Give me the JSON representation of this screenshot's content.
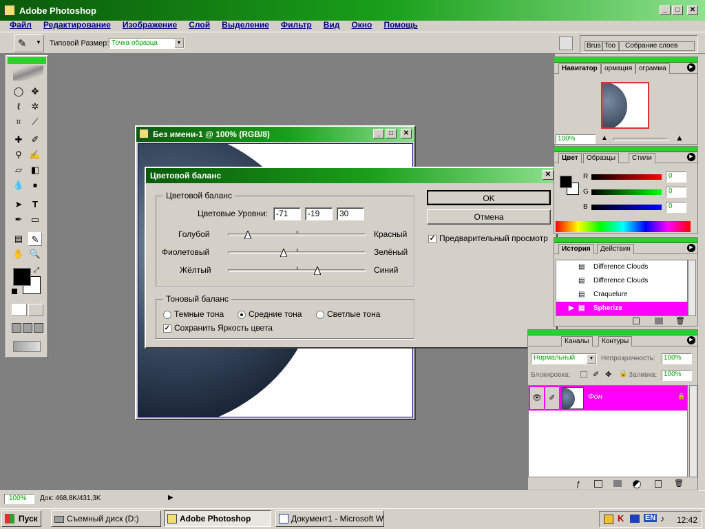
{
  "app": {
    "title": "Adobe Photoshop"
  },
  "menu": [
    "Файл",
    "Редактирование",
    "Изображение",
    "Слой",
    "Выделение",
    "Фильтр",
    "Вид",
    "Окно",
    "Помощь"
  ],
  "options": {
    "sample_label": "Типовой Размер:",
    "sample_value": "Точка образца"
  },
  "palette_well": {
    "tabs": [
      "Brus",
      "Too",
      "Собрание слоев"
    ]
  },
  "document": {
    "title": "Без имени-1 @ 100% (RGB/8)"
  },
  "dialog": {
    "title": "Цветовой баланс",
    "group1_title": "Цветовой баланс",
    "levels_label": "Цветовые Уровни:",
    "levels": [
      "-71",
      "-19",
      "30"
    ],
    "sliders": [
      {
        "left": "Голубой",
        "right": "Красный",
        "value": -71
      },
      {
        "left": "Фиолетовый",
        "right": "Зелёный",
        "value": -19
      },
      {
        "left": "Жёлтый",
        "right": "Синий",
        "value": 30
      }
    ],
    "ok": "OK",
    "cancel": "Отмена",
    "preview": "Предварительный просмотр",
    "tone_title": "Тоновый баланс",
    "tones": [
      "Темные тона",
      "Средние тона",
      "Светлые тона"
    ],
    "selected_tone": 1,
    "preserve": "Сохранить Яркость цвета"
  },
  "navigator": {
    "tabs": [
      "Навигатор",
      "ормация",
      "ограмма"
    ],
    "zoom": "100%"
  },
  "color_panel": {
    "tabs": [
      "Цвет",
      "Образцы",
      "Стили"
    ],
    "channels": [
      {
        "label": "R",
        "value": "0"
      },
      {
        "label": "G",
        "value": "0"
      },
      {
        "label": "B",
        "value": "0"
      }
    ]
  },
  "history": {
    "tabs": [
      "История",
      "Действия"
    ],
    "items": [
      "Difference Clouds",
      "Difference Clouds",
      "Craquelure",
      "Spherize"
    ]
  },
  "layers": {
    "tabs": [
      "Каналы",
      "Контуры"
    ],
    "mode": "Нормальный",
    "opacity_label": "Непрозрачность:",
    "opacity": "100%",
    "lock_label": "Блокировка:",
    "fill_label": "Заливка:",
    "fill": "100%",
    "layer_name": "Фон"
  },
  "status": {
    "zoom": "100%",
    "doc": "Док: 468,8K/431,3K"
  },
  "taskbar": {
    "start": "Пуск",
    "items": [
      "Съемный диск (D:)",
      "Adobe Photoshop",
      "Документ1 - Microsoft W..."
    ],
    "lang": "EN",
    "time": "12:42"
  },
  "colors": {
    "accent": "#00aa00",
    "selection": "#ff00ff",
    "workspace": "#808080"
  }
}
